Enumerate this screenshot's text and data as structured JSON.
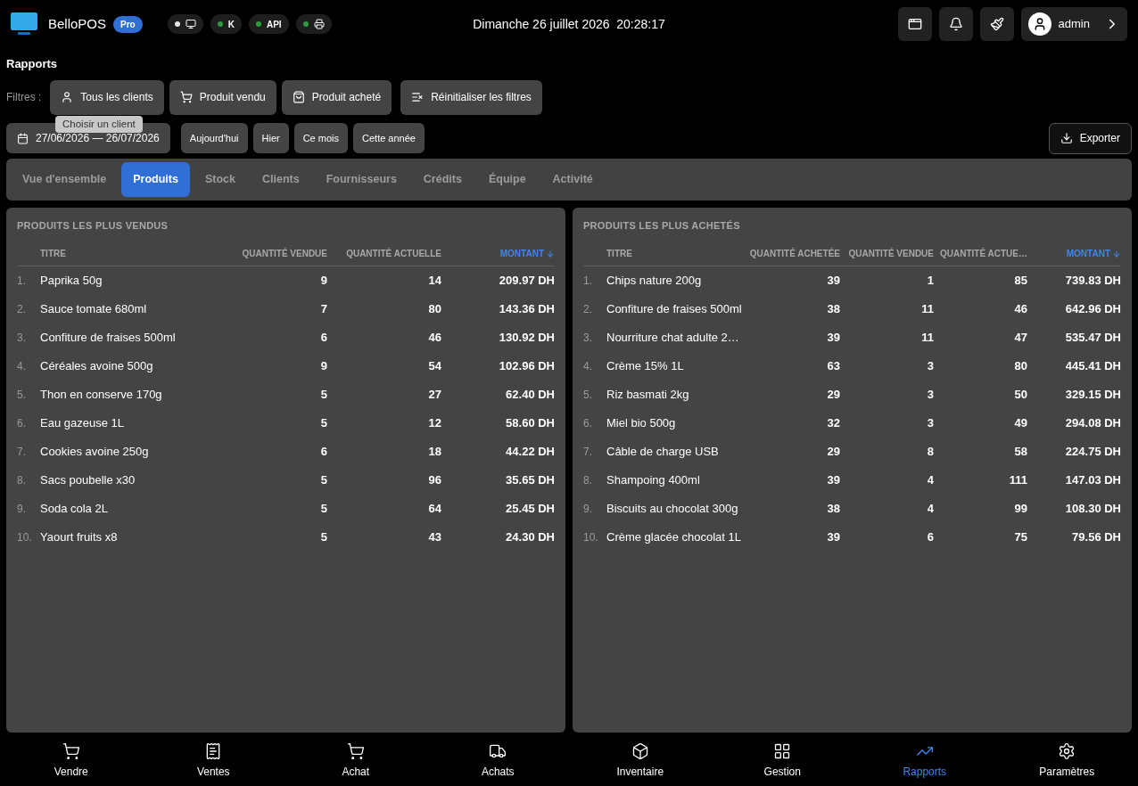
{
  "app": {
    "name": "BelloPOS",
    "badge": "Pro"
  },
  "status_pills": [
    {
      "kind": "monitor",
      "color": "#e5e5e5"
    },
    {
      "kind": "text",
      "label": "K",
      "color": "#2e9b3e"
    },
    {
      "kind": "text",
      "label": "API",
      "color": "#2e9b3e"
    },
    {
      "kind": "printer",
      "color": "#2e9b3e"
    }
  ],
  "datetime": "Dimanche 26 juillet 2026  20:28:17",
  "user": {
    "name": "admin"
  },
  "page_title": "Rapports",
  "filters": {
    "label": "Filtres :",
    "buttons": [
      {
        "kind": "user",
        "label": "Tous les clients"
      },
      {
        "kind": "cart",
        "label": "Produit vendu"
      },
      {
        "kind": "bag",
        "label": "Produit acheté"
      },
      {
        "kind": "reset",
        "label": "Réinitialiser les filtres"
      }
    ],
    "tooltip": "Choisir un client"
  },
  "date_range": "27/06/2026 — 26/07/2026",
  "quick_dates": [
    "Aujourd'hui",
    "Hier",
    "Ce mois",
    "Cette année"
  ],
  "export_button": "Exporter",
  "tabs": [
    {
      "label": "Vue d'ensemble",
      "selected": false
    },
    {
      "label": "Produits",
      "selected": true
    },
    {
      "label": "Stock",
      "selected": false
    },
    {
      "label": "Clients",
      "selected": false
    },
    {
      "label": "Fournisseurs",
      "selected": false
    },
    {
      "label": "Crédits",
      "selected": false
    },
    {
      "label": "Équipe",
      "selected": false
    },
    {
      "label": "Activité",
      "selected": false
    }
  ],
  "panels": [
    {
      "title": "PRODUITS LES PLUS VENDUS",
      "columns": [
        {},
        {
          "label": "TITRE",
          "sorted": false
        },
        {
          "label": "QUANTITÉ VENDUE",
          "sorted": false
        },
        {
          "label": "QUANTITÉ ACTUELLE",
          "sorted": false
        },
        {
          "label": "MONTANT",
          "sorted": true
        }
      ],
      "rows": [
        [
          "1.",
          "Paprika 50g",
          "9",
          "14",
          "209.97 DH"
        ],
        [
          "2.",
          "Sauce tomate 680ml",
          "7",
          "80",
          "143.36 DH"
        ],
        [
          "3.",
          "Confiture de fraises 500ml",
          "6",
          "46",
          "130.92 DH"
        ],
        [
          "4.",
          "Céréales avoine 500g",
          "9",
          "54",
          "102.96 DH"
        ],
        [
          "5.",
          "Thon en conserve 170g",
          "5",
          "27",
          "62.40 DH"
        ],
        [
          "6.",
          "Eau gazeuse 1L",
          "5",
          "12",
          "58.60 DH"
        ],
        [
          "7.",
          "Cookies avoine 250g",
          "6",
          "18",
          "44.22 DH"
        ],
        [
          "8.",
          "Sacs poubelle x30",
          "5",
          "96",
          "35.65 DH"
        ],
        [
          "9.",
          "Soda cola 2L",
          "5",
          "64",
          "25.45 DH"
        ],
        [
          "10.",
          "Yaourt fruits x8",
          "5",
          "43",
          "24.30 DH"
        ]
      ]
    },
    {
      "title": "PRODUITS LES PLUS ACHETÉS",
      "columns": [
        {},
        {
          "label": "TITRE",
          "sorted": false
        },
        {
          "label": "QUANTITÉ ACHETÉE",
          "sorted": false
        },
        {
          "label": "QUANTITÉ VENDUE",
          "sorted": false
        },
        {
          "label": "QUANTITÉ ACTUE…",
          "sorted": false
        },
        {
          "label": "MONTANT",
          "sorted": true
        }
      ],
      "rows": [
        [
          "1.",
          "Chips nature 200g",
          "39",
          "1",
          "85",
          "739.83 DH"
        ],
        [
          "2.",
          "Confiture de fraises 500ml",
          "38",
          "11",
          "46",
          "642.96 DH"
        ],
        [
          "3.",
          "Nourriture chat adulte 2…",
          "39",
          "11",
          "47",
          "535.47 DH"
        ],
        [
          "4.",
          "Crème 15% 1L",
          "63",
          "3",
          "80",
          "445.41 DH"
        ],
        [
          "5.",
          "Riz basmati 2kg",
          "29",
          "3",
          "50",
          "329.15 DH"
        ],
        [
          "6.",
          "Miel bio 500g",
          "32",
          "3",
          "49",
          "294.08 DH"
        ],
        [
          "7.",
          "Câble de charge USB",
          "29",
          "8",
          "58",
          "224.75 DH"
        ],
        [
          "8.",
          "Shampoing 400ml",
          "39",
          "4",
          "111",
          "147.03 DH"
        ],
        [
          "9.",
          "Biscuits au chocolat 300g",
          "38",
          "4",
          "99",
          "108.30 DH"
        ],
        [
          "10.",
          "Crème glacée chocolat 1L",
          "39",
          "6",
          "75",
          "79.56 DH"
        ]
      ]
    }
  ],
  "bottom_nav": [
    {
      "kind": "cart",
      "label": "Vendre",
      "selected": false
    },
    {
      "kind": "receipt",
      "label": "Ventes",
      "selected": false
    },
    {
      "kind": "cart",
      "label": "Achat",
      "selected": false
    },
    {
      "kind": "truck",
      "label": "Achats",
      "selected": false
    },
    {
      "kind": "box",
      "label": "Inventaire",
      "selected": false
    },
    {
      "kind": "grid",
      "label": "Gestion",
      "selected": false
    },
    {
      "kind": "chart",
      "label": "Rapports",
      "selected": true
    },
    {
      "kind": "gear",
      "label": "Paramètres",
      "selected": false
    }
  ]
}
